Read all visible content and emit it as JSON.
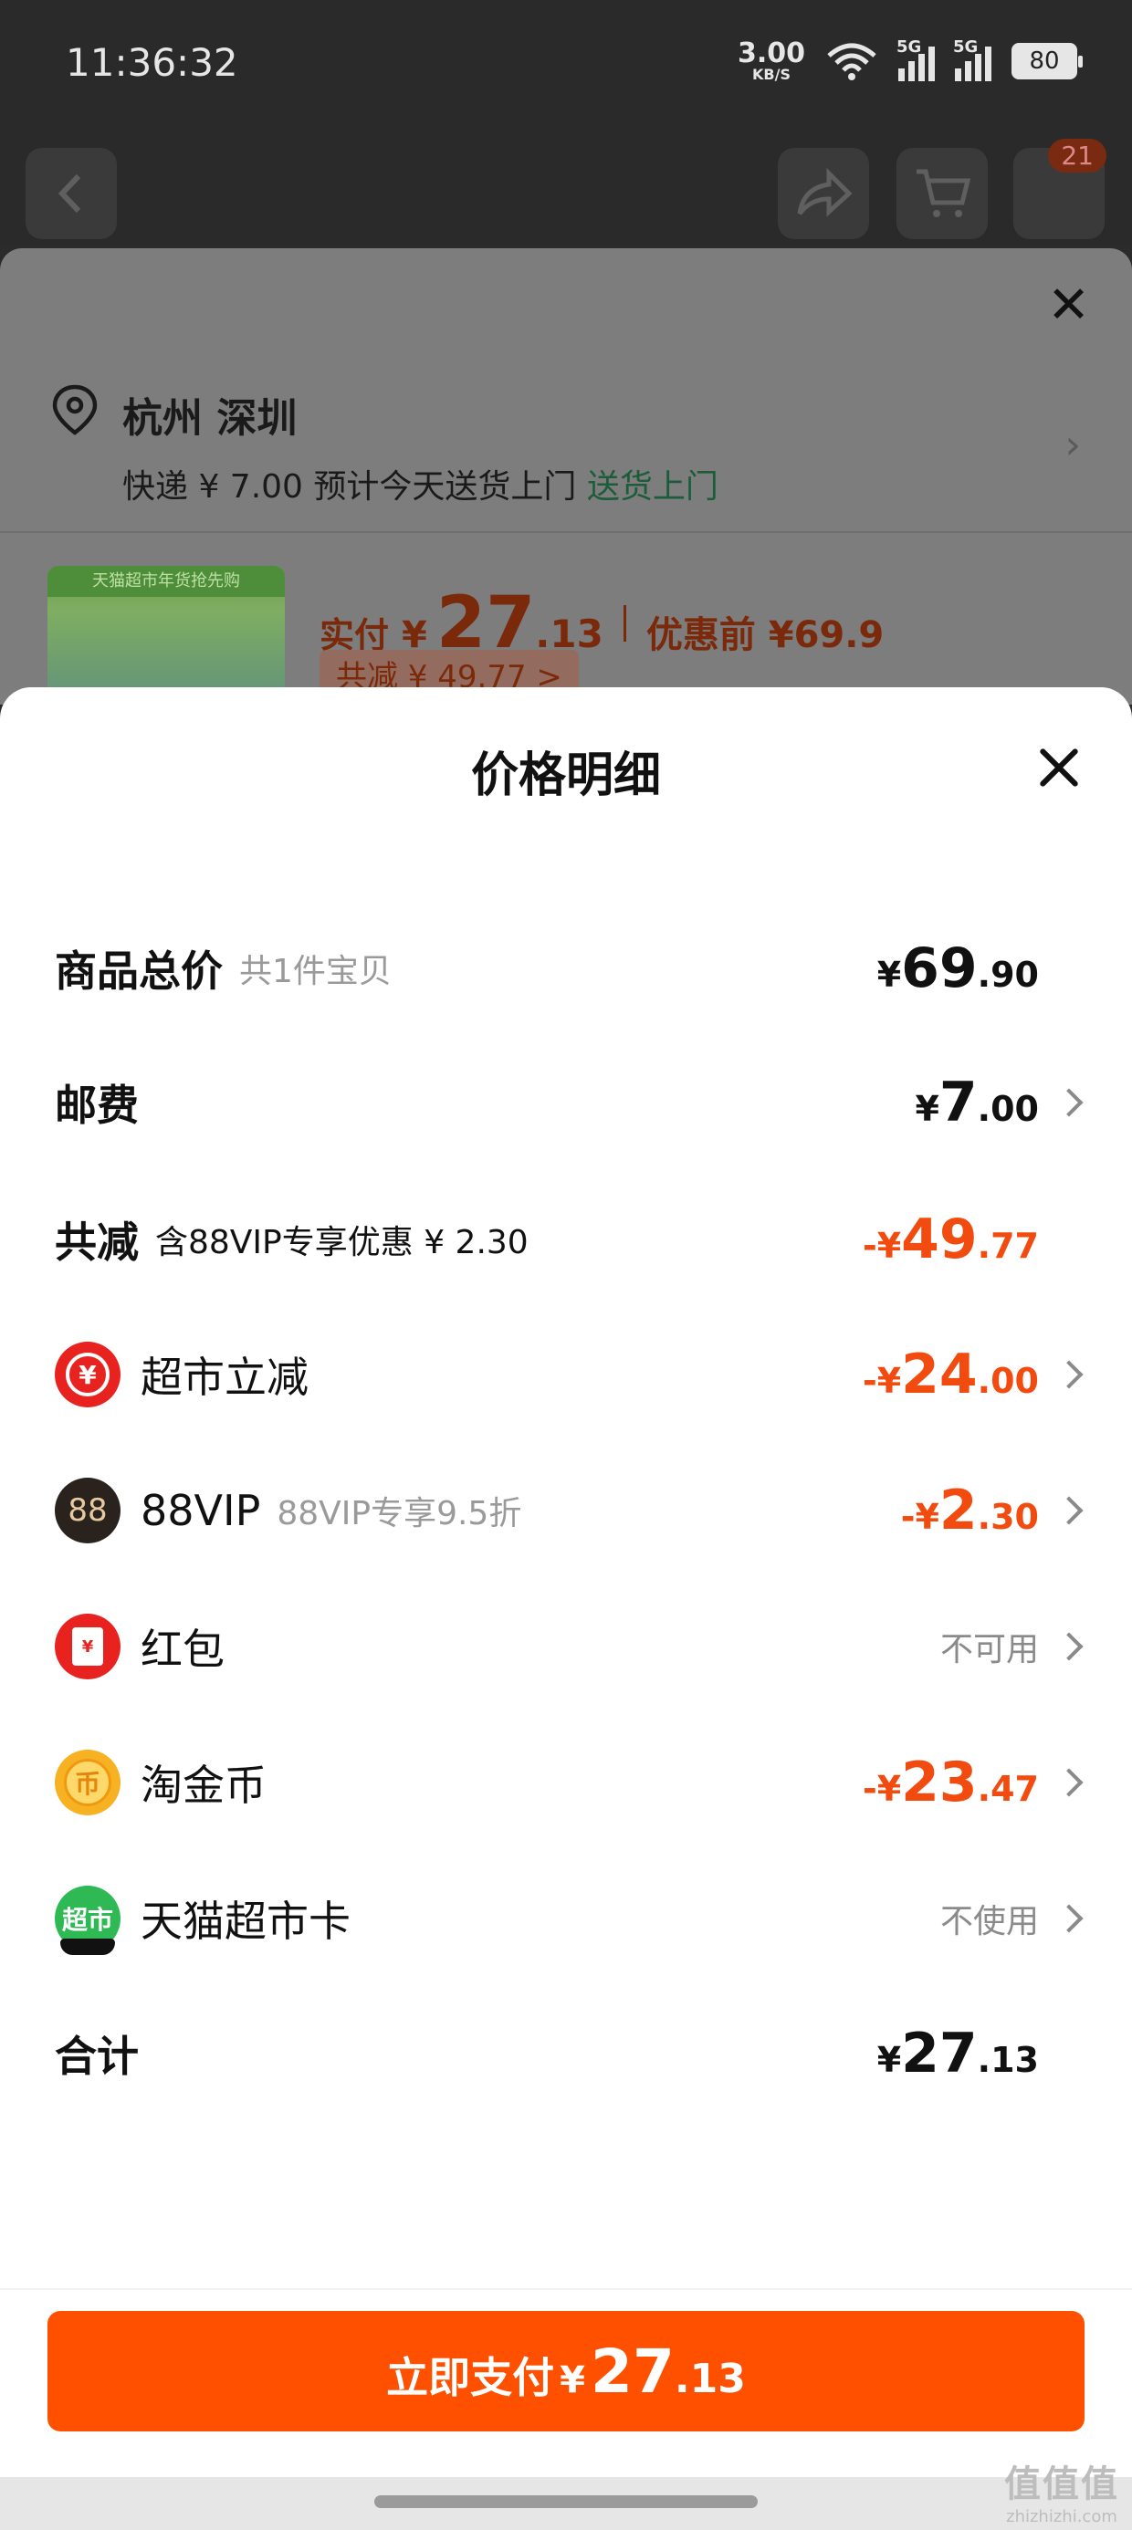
{
  "status_bar": {
    "time": "11:36:32",
    "net_speed_value": "3.00",
    "net_speed_unit": "KB/S",
    "sim1_label": "5G",
    "sim2_label": "5G",
    "battery": "80"
  },
  "top_nav": {
    "cart_badge": "21"
  },
  "background_sheet": {
    "close_glyph": "✕",
    "city": "杭州 深圳",
    "shipping_text": "快递 ¥ 7.00 预计今天送货上门",
    "shipping_highlight": "送货上门",
    "product_banner": "天猫超市年货抢先购",
    "paid_label": "实付",
    "paid_yen": "¥",
    "paid_int": "27",
    "paid_dec": ".13",
    "original_label": "优惠前 ¥69.9",
    "saved_tag": "共减 ¥ 49.77 >"
  },
  "price_detail": {
    "title": "价格明细",
    "rows": {
      "subtotal": {
        "label": "商品总价",
        "note": "共1件宝贝",
        "yen": "¥",
        "int": "69",
        "dec": ".90"
      },
      "shipping": {
        "label": "邮费",
        "yen": "¥",
        "int": "7",
        "dec": ".00"
      },
      "total_discount": {
        "label": "共减",
        "note": "含88VIP专享优惠 ¥ 2.30",
        "yen": "-¥",
        "int": "49",
        "dec": ".77"
      },
      "supermarket": {
        "label": "超市立减",
        "icon_glyph": "¥",
        "yen": "-¥",
        "int": "24",
        "dec": ".00"
      },
      "vip": {
        "label": "88VIP",
        "icon_glyph": "88",
        "note": "88VIP专享9.5折",
        "yen": "-¥",
        "int": "2",
        "dec": ".30"
      },
      "redpacket": {
        "label": "红包",
        "icon_glyph": "¥",
        "status": "不可用"
      },
      "coins": {
        "label": "淘金币",
        "icon_glyph": "币",
        "yen": "-¥",
        "int": "23",
        "dec": ".47"
      },
      "card": {
        "label": "天猫超市卡",
        "icon_glyph": "超市",
        "status": "不使用"
      },
      "total": {
        "label": "合计",
        "yen": "¥",
        "int": "27",
        "dec": ".13"
      }
    },
    "pay_button": {
      "label": "立即支付",
      "yen": "¥",
      "int": "27",
      "dec": ".13"
    }
  },
  "watermark": {
    "big": "值值值",
    "small": "zhizhizhi.com"
  },
  "colors": {
    "accent_orange": "#ff5000",
    "discount_orange": "#f24b0f"
  }
}
